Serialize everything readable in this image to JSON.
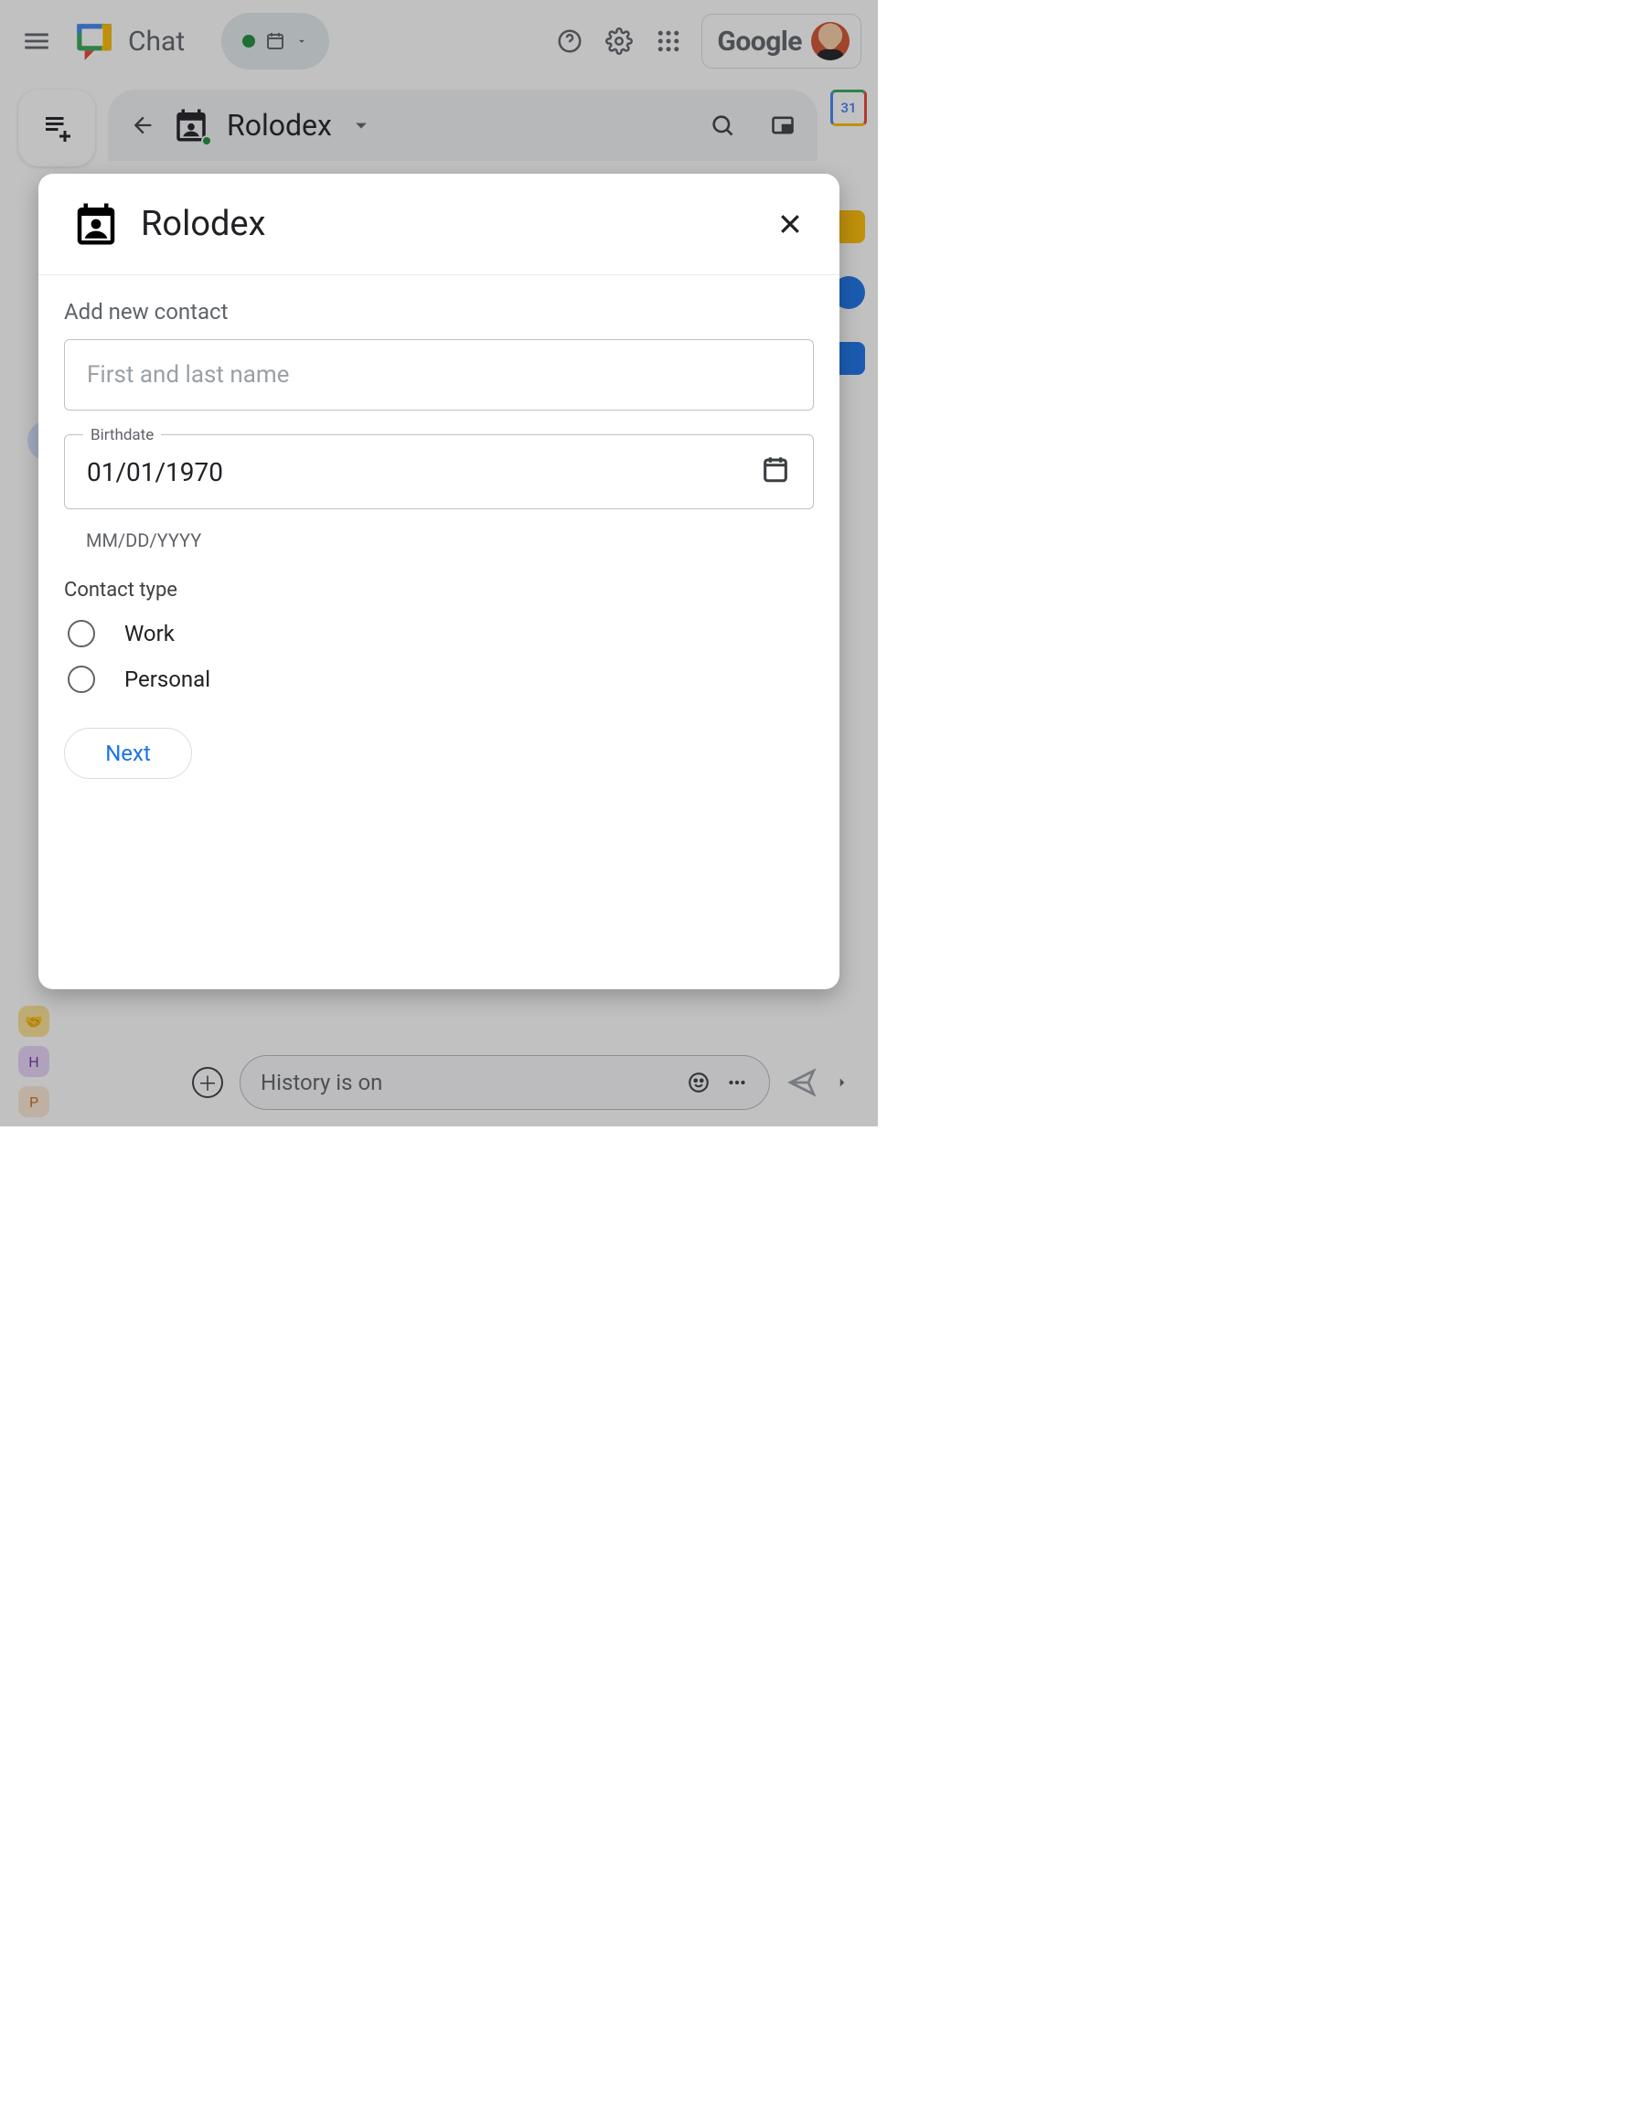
{
  "header": {
    "app_name": "Chat",
    "google_label": "Google",
    "calendar_badge": "31"
  },
  "space": {
    "title": "Rolodex"
  },
  "compose": {
    "placeholder": "History is on"
  },
  "mini_avatars": {
    "h": "H",
    "p": "P"
  },
  "dialog": {
    "title": "Rolodex",
    "section_heading": "Add new contact",
    "name_placeholder": "First and last name",
    "birthdate_label": "Birthdate",
    "birthdate_value": "01/01/1970",
    "birthdate_help": "MM/DD/YYYY",
    "contact_type_label": "Contact type",
    "options": {
      "work": "Work",
      "personal": "Personal"
    },
    "next_label": "Next"
  }
}
